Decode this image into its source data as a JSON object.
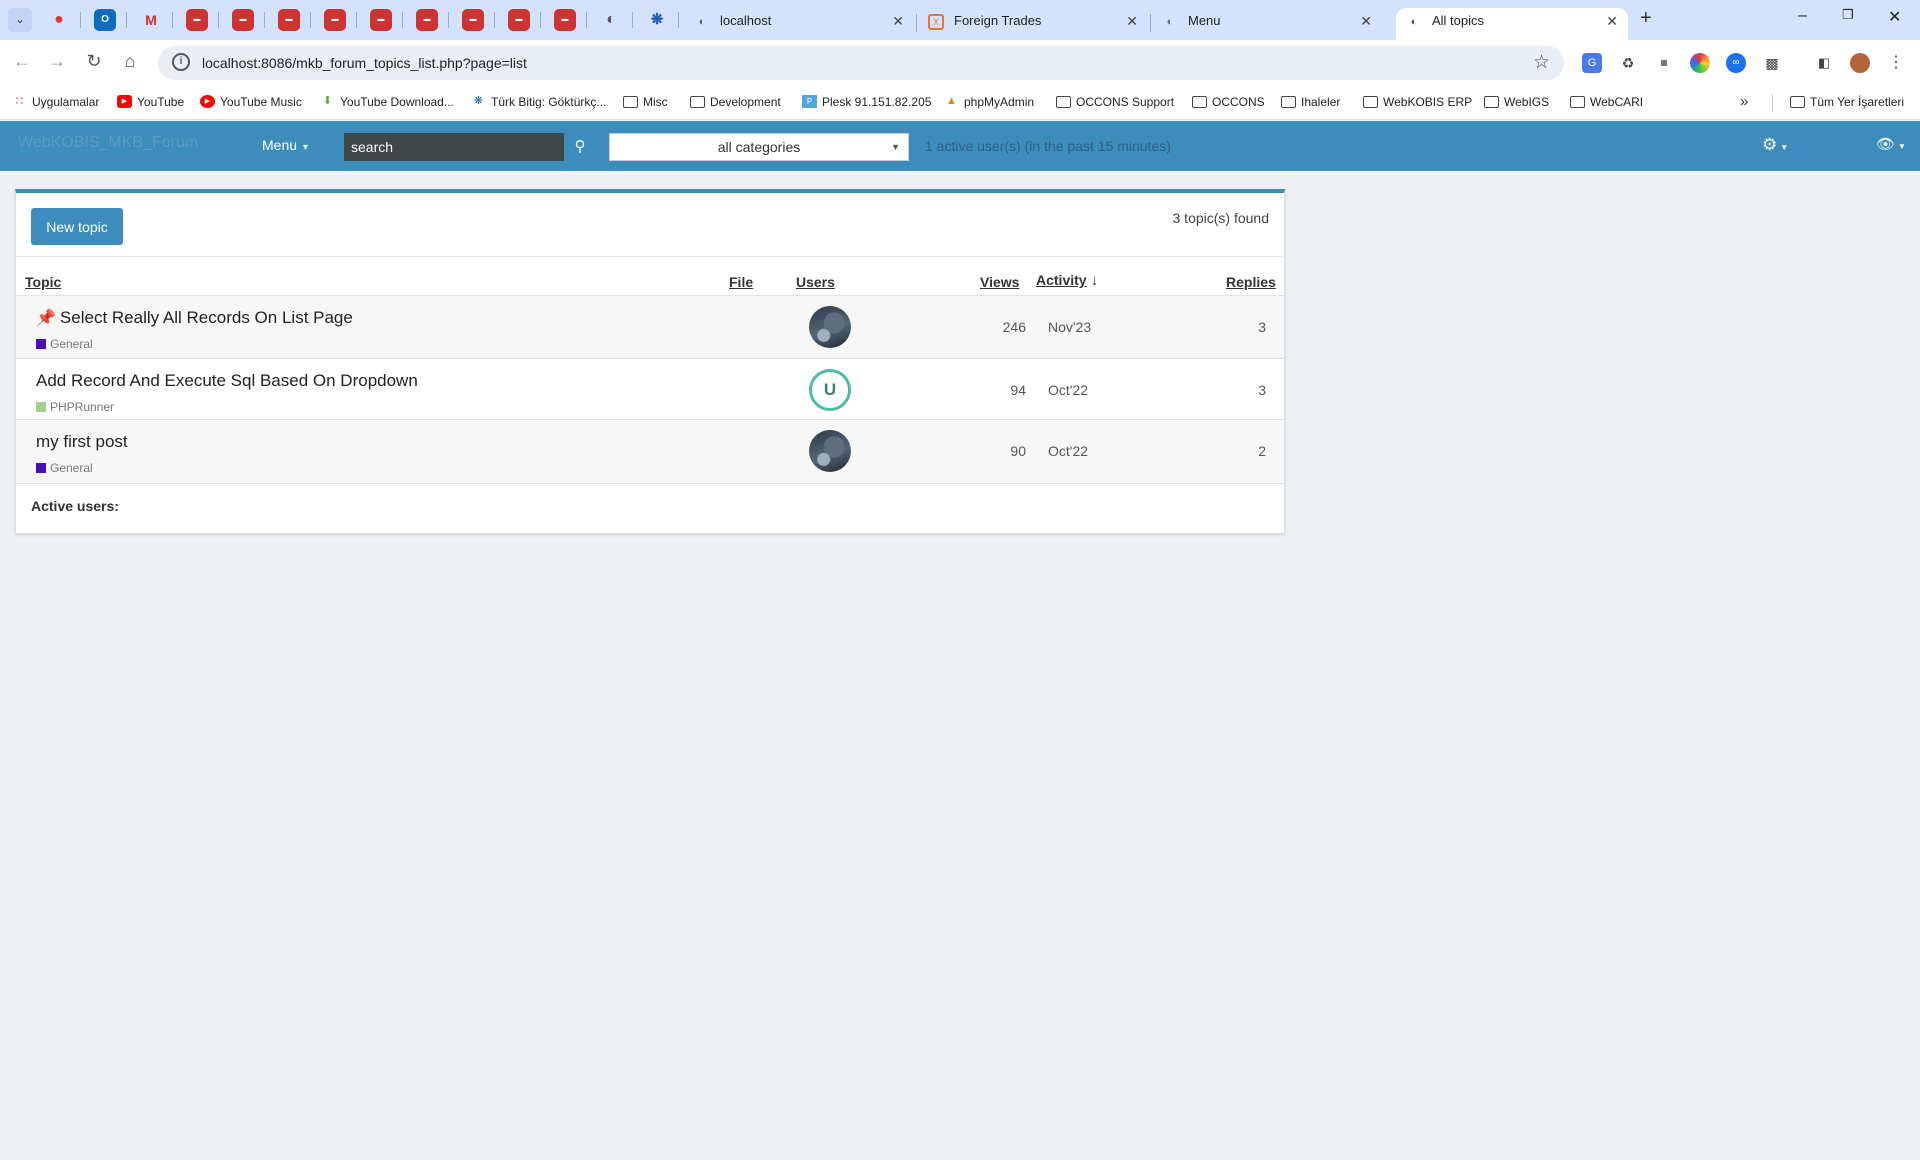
{
  "browser": {
    "tabs": [
      {
        "label": "localhost"
      },
      {
        "label": "Foreign Trades"
      },
      {
        "label": "Menu"
      },
      {
        "label": "All topics"
      }
    ],
    "url": "localhost:8086/mkb_forum_topics_list.php?page=list",
    "bookmarks": [
      {
        "label": "Uygulamalar"
      },
      {
        "label": "YouTube"
      },
      {
        "label": "YouTube Music"
      },
      {
        "label": "YouTube Download..."
      },
      {
        "label": "Türk Bitig: Göktürkç..."
      },
      {
        "label": "Misc"
      },
      {
        "label": "Development"
      },
      {
        "label": "Plesk 91.151.82.205"
      },
      {
        "label": "phpMyAdmin"
      },
      {
        "label": "OCCONS Support"
      },
      {
        "label": "OCCONS"
      },
      {
        "label": "Ihaleler"
      },
      {
        "label": "WebKOBIS ERP"
      },
      {
        "label": "WebIGS"
      },
      {
        "label": "WebCARI"
      }
    ],
    "other_bookmarks": "Tüm Yer İşaretleri"
  },
  "app": {
    "brand": "WebKOBIS_MKB_Forum",
    "menu_label": "Menu",
    "search_value": "search",
    "category_value": "all categories",
    "active_users_top": "1 active user(s) (in the past 15 minutes)",
    "accent": "#3c8dbc"
  },
  "list": {
    "new_topic_label": "New topic",
    "found_text": "3 topic(s) found",
    "headers": {
      "topic": "Topic",
      "file": "File",
      "users": "Users",
      "views": "Views",
      "activity": "Activity",
      "replies": "Replies"
    },
    "rows": [
      {
        "title": "Select Really All Records On List Page",
        "pinned": true,
        "category": "General",
        "category_color": "#4b10b5",
        "user": "",
        "views": "246",
        "activity": "Nov'23",
        "replies": "3"
      },
      {
        "title": "Add Record And Execute Sql Based On Dropdown",
        "pinned": false,
        "category": "PHPRunner",
        "category_color": "#9ed08a",
        "user": "U",
        "views": "94",
        "activity": "Oct'22",
        "replies": "3"
      },
      {
        "title": "my first post",
        "pinned": false,
        "category": "General",
        "category_color": "#4b10b5",
        "user": "",
        "views": "90",
        "activity": "Oct'22",
        "replies": "2"
      }
    ],
    "active_users_label": "Active users:"
  }
}
